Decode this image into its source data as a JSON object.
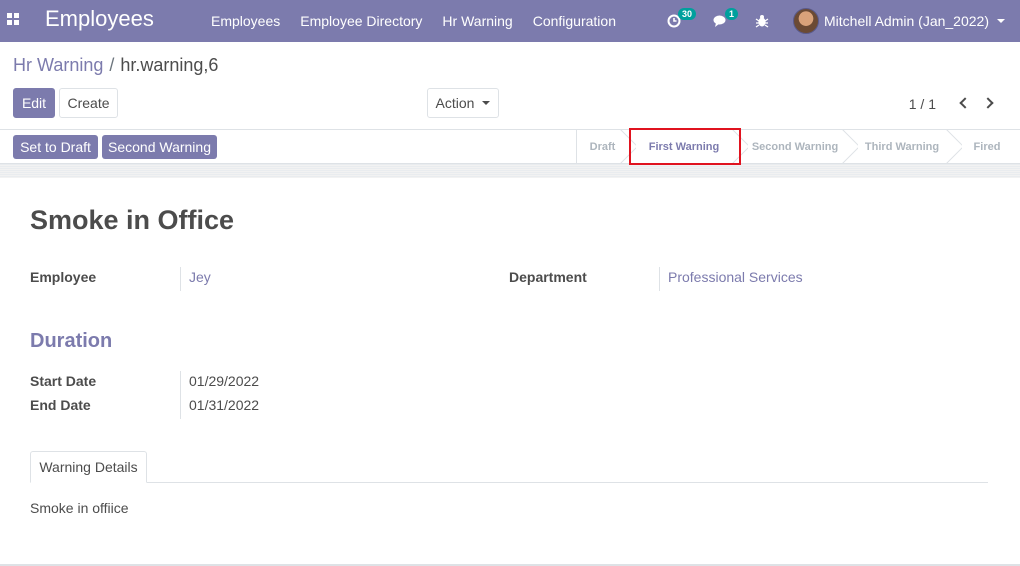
{
  "navbar": {
    "app_title": "Employees",
    "menu": [
      "Employees",
      "Employee Directory",
      "Hr Warning",
      "Configuration"
    ],
    "activity_count": "30",
    "message_count": "1",
    "user": "Mitchell Admin (Jan_2022)",
    "bg_color": "#7c7bad"
  },
  "breadcrumb": {
    "parent": "Hr Warning",
    "separator": "/",
    "current": "hr.warning,6"
  },
  "controls": {
    "edit": "Edit",
    "create": "Create",
    "action": "Action",
    "pager": "1 / 1"
  },
  "statusbar": {
    "buttons": [
      "Set to Draft",
      "Second Warning"
    ],
    "stages": [
      "Draft",
      "First Warning",
      "Second Warning",
      "Third Warning",
      "Fired"
    ],
    "active_stage": "First Warning",
    "highlight_color": "#e0131f"
  },
  "form": {
    "title": "Smoke in Office",
    "employee_label": "Employee",
    "employee_value": "Jey",
    "department_label": "Department",
    "department_value": "Professional Services",
    "section_title": "Duration",
    "start_label": "Start Date",
    "start_value": "01/29/2022",
    "end_label": "End Date",
    "end_value": "01/31/2022"
  },
  "notebook": {
    "tab_label": "Warning Details",
    "content": "Smoke in offiice"
  }
}
